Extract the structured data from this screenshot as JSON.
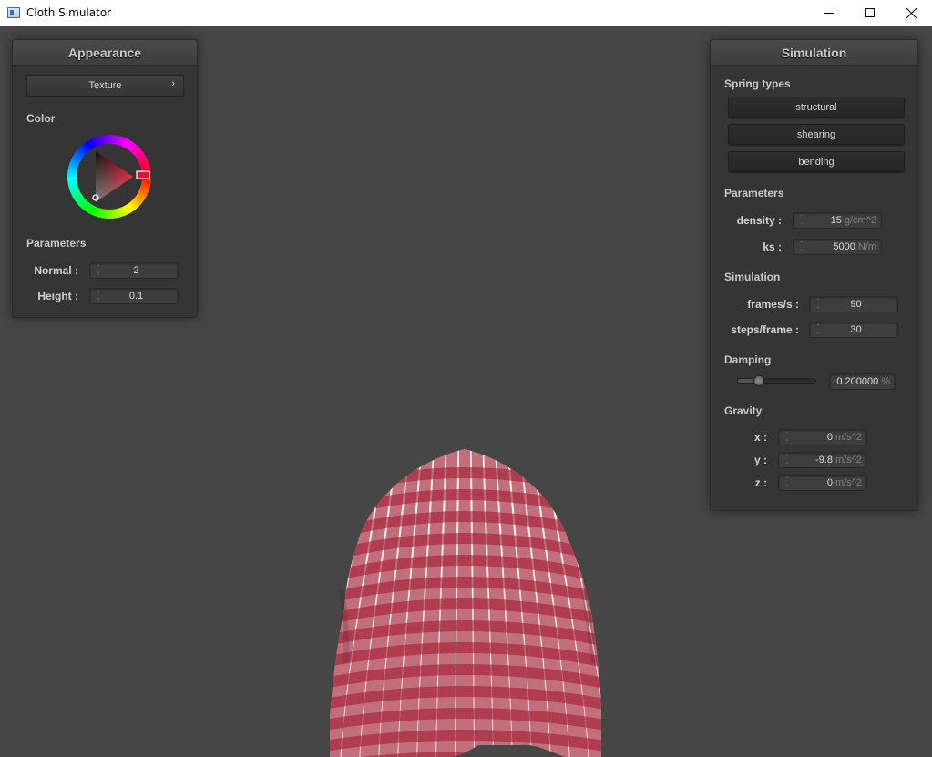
{
  "window": {
    "title": "Cloth Simulator"
  },
  "appearance": {
    "header": "Appearance",
    "texture_button": "Texture",
    "color_label": "Color",
    "color_wheel": {
      "hue_color": "#e8102a"
    },
    "parameters_label": "Parameters",
    "normal_label": "Normal :",
    "normal_value": "2",
    "height_label": "Height :",
    "height_value": "0.1"
  },
  "simulation": {
    "header": "Simulation",
    "spring_types_label": "Spring types",
    "spring_buttons": [
      "structural",
      "shearing",
      "bending"
    ],
    "parameters_label": "Parameters",
    "density_label": "density :",
    "density_value": "15",
    "density_unit": "g/cm^2",
    "ks_label": "ks :",
    "ks_value": "5000",
    "ks_unit": "N/m",
    "simulation_label": "Simulation",
    "frames_label": "frames/s :",
    "frames_value": "90",
    "steps_label": "steps/frame :",
    "steps_value": "30",
    "damping_label": "Damping",
    "damping_slider_fraction": 0.2,
    "damping_value": "0.200000",
    "damping_unit": "%",
    "gravity_label": "Gravity",
    "gx_label": "x :",
    "gx_value": "0",
    "gy_label": "y :",
    "gy_value": "-9.8",
    "gz_label": "z :",
    "gz_value": "0",
    "gravity_unit": "m/s^2"
  },
  "scene": {
    "cloth_colors": {
      "red": "#a51f34",
      "white": "#f2eef0",
      "pink": "#cf8c9a"
    }
  }
}
